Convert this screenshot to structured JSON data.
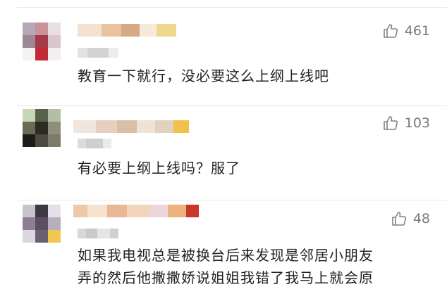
{
  "comments": [
    {
      "likes": "461",
      "text_lines": [
        "教育一下就行，没必要这么上纲上线吧"
      ],
      "avatar_colors": [
        "#b6a7b9",
        "#c8929a",
        "#eadfe4",
        "#9d8696",
        "#a63a47",
        "#d9c6cf",
        "#f4f2f3",
        "#c22a35",
        "#f3eef0"
      ],
      "name_colors": [
        "#f5e1d2",
        "#e9c39f",
        "#d7a985",
        "#f7eadc",
        "#f0d78e"
      ],
      "meta_colors": [
        "#e2e2e2",
        "#d3d3d3",
        "#ececec"
      ]
    },
    {
      "likes": "103",
      "text_lines": [
        "有必要上纲上线吗？服了"
      ],
      "avatar_colors": [
        "#c7d5b8",
        "#58614b",
        "#b4bea6",
        "#6a6a55",
        "#2b2b22",
        "#8d8f78",
        "#1c1c18",
        "#4d4b3f",
        "#7d7a6a"
      ],
      "name_colors": [
        "#f0e6de",
        "#e6cfbf",
        "#d9bfa6",
        "#efe3d6",
        "#e2d0c1",
        "#f2c14a"
      ],
      "meta_colors": [
        "#dcdcdc",
        "#cfcfcf",
        "#ebebeb"
      ]
    },
    {
      "likes": "48",
      "text_lines": [
        "如果我电视总是被换台后来发现是邻居小朋友",
        "弄的然后他撒撒娇说姐姐我错了我马上就会原"
      ],
      "avatar_colors": [
        "#c9c3cd",
        "#3d3842",
        "#e5dfe7",
        "#8e7d93",
        "#5a4f62",
        "#b9aebc",
        "#dcd6de",
        "#6b6071",
        "#f0c850"
      ],
      "name_colors": [
        "#efc9a7",
        "#f6e2cf",
        "#e8b793",
        "#f3d5bc",
        "#ecd6dc",
        "#e9b27e",
        "#c9372b"
      ],
      "meta_colors": [
        "#d8d8d8",
        "#c9c9c9",
        "#e5e5e5",
        "#d0d0d0"
      ]
    }
  ]
}
